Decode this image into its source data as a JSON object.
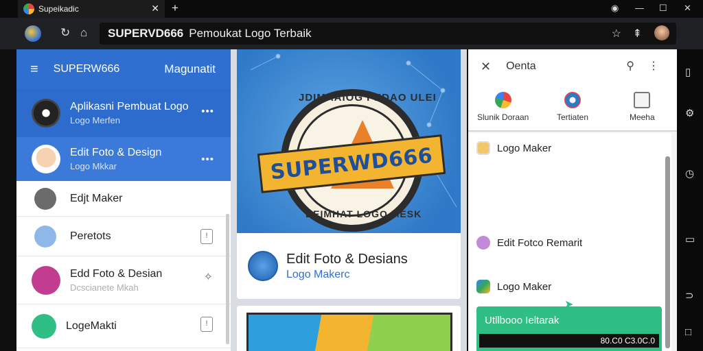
{
  "browser": {
    "tab_title": "Supeikadic",
    "omnibox_title": "SUPERVD666",
    "omnibox_rest": "Pemoukat Logo Terbaik"
  },
  "sidebar": {
    "title": "SUPERW666",
    "right_label": "Magunatit",
    "items": [
      {
        "title": "Aplikasni Pembuat Logo",
        "subtitle": "Logo Merfen"
      },
      {
        "title": "Edit Foto & Design",
        "subtitle": "Logo Mkkar"
      },
      {
        "title": "Edjt Maker"
      },
      {
        "title": "Peretots"
      },
      {
        "title": "Edd Foto & Desian",
        "subtitle": "Dcscianete Mkah"
      },
      {
        "title": "LogeMakti"
      }
    ]
  },
  "hero": {
    "badge_text": "SUPERWD666",
    "ring_top": "JDIMAAIOG PEDAO ULEI",
    "ring_bottom": "DEIMHAT LOGO MESK"
  },
  "card": {
    "title": "Edit Foto & Desians",
    "subtitle": "Logo Makerc"
  },
  "right_panel": {
    "title": "Oenta",
    "quick": [
      {
        "label": "Slunik Doraan"
      },
      {
        "label": "Tertiaten"
      },
      {
        "label": "Meeha"
      }
    ],
    "list": [
      {
        "label": "Logo Maker"
      },
      {
        "label": "Edit Fotco Remarit"
      },
      {
        "label": "Logo Maker"
      }
    ],
    "promo_title": "Utllbooo Ieltarak",
    "promo_bar": "80.C0 C3.0C.0"
  }
}
